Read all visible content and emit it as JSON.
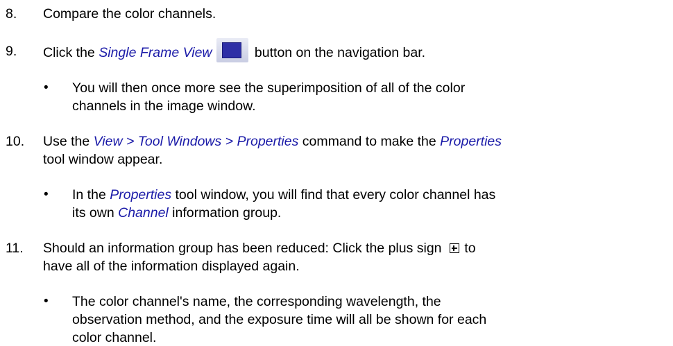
{
  "steps": [
    {
      "num": "8.",
      "text": "Compare the color channels."
    },
    {
      "num": "9.",
      "pre": "Click the ",
      "em": "Single Frame View",
      "post": " button on the navigation bar.",
      "icon": "single-frame-view-icon"
    },
    {
      "bullet": "You will then once more see the superimposition of all of the color",
      "bullet_2": "channels in the image window."
    },
    {
      "num": "10.",
      "pre": "Use the ",
      "em": "View > Tool Windows > Properties",
      "mid": " command to make the ",
      "em2": "Properties",
      "line2": "tool window appear."
    },
    {
      "bullet_pre": "In the ",
      "bullet_em": "Properties",
      "bullet_post": " tool window, you will find that every color channel has",
      "bullet_2_pre": "its own ",
      "bullet_2_em": "Channel",
      "bullet_2_post": " information group."
    },
    {
      "num": "11.",
      "pre": "Should an information group has been reduced: Click the plus sign ",
      "post": " to",
      "icon": "plus-sign-icon",
      "line2": "have all of the information displayed again."
    },
    {
      "bullet": "The color channel's name, the corresponding wavelength, the",
      "bullet_2": "observation method, and the exposure time will all be shown for each",
      "bullet_3": "color channel."
    }
  ],
  "bullet_char": "•"
}
